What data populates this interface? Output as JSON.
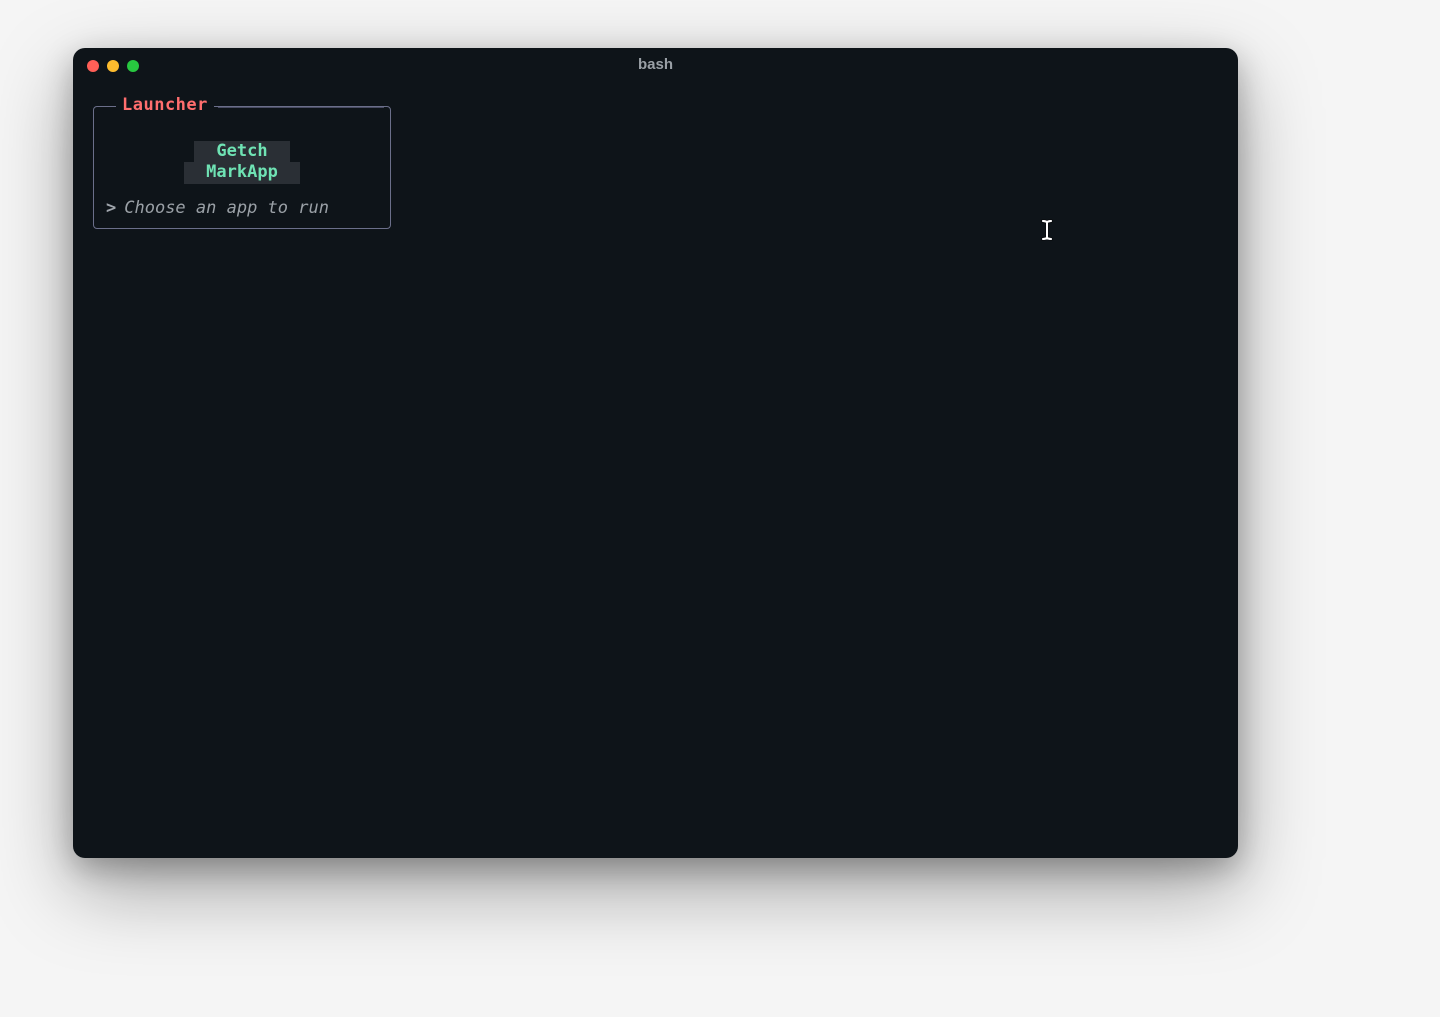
{
  "window": {
    "title": "bash"
  },
  "launcher": {
    "title": "Launcher",
    "items": [
      {
        "label": "Getch"
      },
      {
        "label": "MarkApp"
      }
    ],
    "prompt_caret": ">",
    "prompt_hint": "Choose an app to run"
  }
}
